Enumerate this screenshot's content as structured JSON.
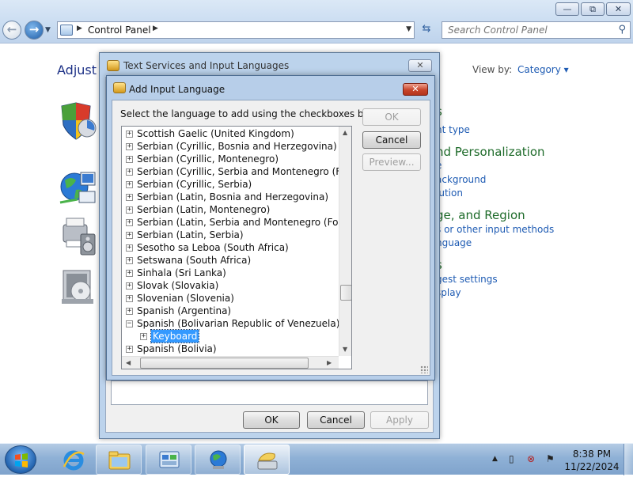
{
  "window": {
    "minimize_glyph": "—",
    "maximize_glyph": "⧉",
    "close_glyph": "✕"
  },
  "address": {
    "path_segment": "Control Panel",
    "search_placeholder": "Search Control Panel"
  },
  "control_panel": {
    "heading": "Adjust y",
    "view_by_label": "View by:",
    "view_by_value": "Category",
    "fragments": [
      "s",
      "nt type",
      "nd Personalization",
      "e",
      "ackground",
      "lution",
      "ge, and Region",
      "s or other input methods",
      "nguage",
      "s",
      "gest settings",
      "splay"
    ]
  },
  "text_services": {
    "title": "Text Services and Input Languages",
    "ok_label": "OK",
    "cancel_label": "Cancel",
    "apply_label": "Apply"
  },
  "add_input_language": {
    "title": "Add Input Language",
    "instruction": "Select the language to add using the checkboxes below.",
    "ok_label": "OK",
    "cancel_label": "Cancel",
    "preview_label": "Preview...",
    "tree": [
      "Scottish Gaelic (United Kingdom)",
      "Serbian (Cyrillic, Bosnia and Herzegovina)",
      "Serbian (Cyrillic, Montenegro)",
      "Serbian (Cyrillic, Serbia and Montenegro (Former))",
      "Serbian (Cyrillic, Serbia)",
      "Serbian (Latin, Bosnia and Herzegovina)",
      "Serbian (Latin, Montenegro)",
      "Serbian (Latin, Serbia and Montenegro (Former))",
      "Serbian (Latin, Serbia)",
      "Sesotho sa Leboa (South Africa)",
      "Setswana (South Africa)",
      "Sinhala (Sri Lanka)",
      "Slovak (Slovakia)",
      "Slovenian (Slovenia)",
      "Spanish (Argentina)",
      "Spanish (Bolivarian Republic of Venezuela)",
      "Keyboard",
      "Spanish (Bolivia)"
    ],
    "expander_collapsed": "+",
    "expander_expanded": "−"
  },
  "taskbar": {
    "time": "8:38 PM",
    "date": "11/22/2024",
    "tray_arrow": "▲"
  }
}
